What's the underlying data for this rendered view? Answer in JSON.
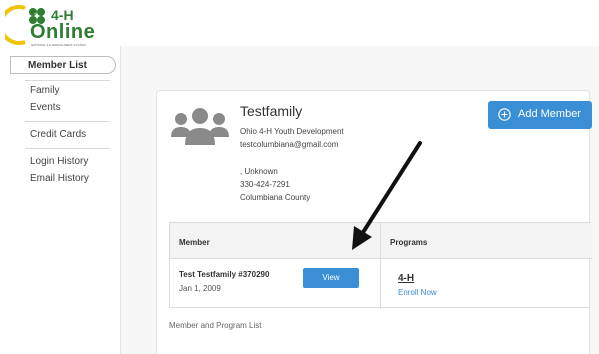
{
  "header": {
    "logo_text": "Online",
    "logo_h": "4-H",
    "logo_tagline": "NATIONAL 4-H ENROLLMENT SYSTEM",
    "logo_icon": "four-leaf-clover-icon"
  },
  "sidebar": {
    "items": [
      {
        "label": "Member List"
      },
      {
        "label": "Family"
      },
      {
        "label": "Events"
      },
      {
        "label": "Credit Cards"
      },
      {
        "label": "Login History"
      },
      {
        "label": "Email History"
      }
    ]
  },
  "family": {
    "name": "Testfamily",
    "organization": "Ohio 4-H Youth Development",
    "email": "testcolumbiana@gmail.com",
    "address": ", Unknown",
    "phone": "330-424-7291",
    "county": "Columbiana County",
    "avatar_icon": "group-avatar-icon"
  },
  "actions": {
    "add_member_label": "Add Member",
    "add_member_icon": "plus-circle-icon"
  },
  "table": {
    "columns": [
      "Member",
      "Programs"
    ],
    "rows": [
      {
        "member_name": "Test Testfamily #370290",
        "dob": "Jan 1, 2009",
        "view_label": "View",
        "program": "4-H",
        "enroll_label": "Enroll Now"
      }
    ],
    "footer": "Member and Program List"
  },
  "colors": {
    "accent": "#3a8ed6",
    "brand_green": "#2e7d32",
    "brand_yellow": "#f2c300"
  }
}
